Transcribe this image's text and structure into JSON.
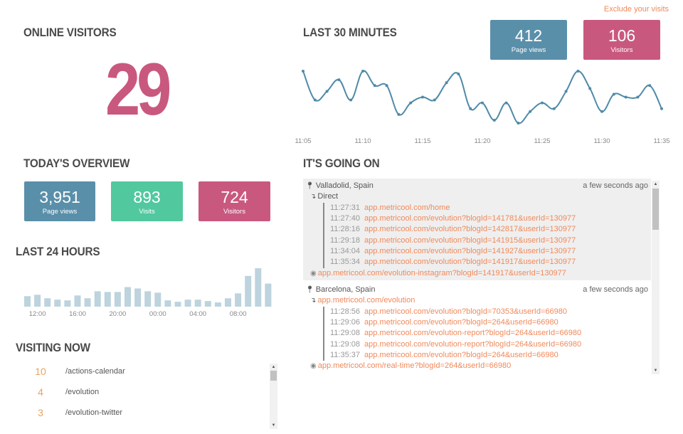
{
  "header": {
    "exclude_link": "Exclude your visits"
  },
  "online_visitors": {
    "title": "ONLINE VISITORS",
    "count": "29"
  },
  "last_30_minutes": {
    "title": "LAST 30 MINUTES",
    "page_views": {
      "value": "412",
      "label": "Page views"
    },
    "visitors": {
      "value": "106",
      "label": "Visitors"
    }
  },
  "todays_overview": {
    "title": "TODAY'S OVERVIEW",
    "page_views": {
      "value": "3,951",
      "label": "Page views"
    },
    "visits": {
      "value": "893",
      "label": "Visits"
    },
    "visitors": {
      "value": "724",
      "label": "Visitors"
    }
  },
  "last_24_hours": {
    "title": "LAST 24 HOURS"
  },
  "visiting_now": {
    "title": "VISITING NOW",
    "items": [
      {
        "count": "10",
        "path": "/actions-calendar"
      },
      {
        "count": "4",
        "path": "/evolution"
      },
      {
        "count": "3",
        "path": "/evolution-twitter"
      }
    ]
  },
  "its_going_on": {
    "title": "IT'S GOING ON",
    "sessions": [
      {
        "location": "Valladolid, Spain",
        "time_ago": "a few seconds ago",
        "referrer": "Direct",
        "referrer_is_link": false,
        "visits": [
          {
            "time": "11:27:31",
            "url": "app.metricool.com/home"
          },
          {
            "time": "11:27:40",
            "url": "app.metricool.com/evolution?blogId=141781&userId=130977"
          },
          {
            "time": "11:28:16",
            "url": "app.metricool.com/evolution?blogId=142817&userId=130977"
          },
          {
            "time": "11:29:18",
            "url": "app.metricool.com/evolution?blogId=141915&userId=130977"
          },
          {
            "time": "11:34:04",
            "url": "app.metricool.com/evolution?blogId=141927&userId=130977"
          },
          {
            "time": "11:35:34",
            "url": "app.metricool.com/evolution?blogId=141917&userId=130977"
          }
        ],
        "current_page": "app.metricool.com/evolution-instagram?blogId=141917&userId=130977"
      },
      {
        "location": "Barcelona, Spain",
        "time_ago": "a few seconds ago",
        "referrer": "app.metricool.com/evolution",
        "referrer_is_link": true,
        "visits": [
          {
            "time": "11:28:56",
            "url": "app.metricool.com/evolution?blogId=70353&userId=66980"
          },
          {
            "time": "11:29:06",
            "url": "app.metricool.com/evolution?blogId=264&userId=66980"
          },
          {
            "time": "11:29:08",
            "url": "app.metricool.com/evolution-report?blogId=264&userId=66980"
          },
          {
            "time": "11:29:08",
            "url": "app.metricool.com/evolution-report?blogId=264&userId=66980"
          },
          {
            "time": "11:35:37",
            "url": "app.metricool.com/evolution?blogId=264&userId=66980"
          }
        ],
        "current_page": "app.metricool.com/real-time?blogId=264&userId=66980"
      }
    ]
  },
  "icons": {
    "location": "map-marker-icon",
    "referrer": "level-down-icon",
    "current_page": "eye-icon"
  },
  "colors": {
    "blue": "#5a8faa",
    "pink": "#c9587f",
    "green": "#52c89f",
    "link": "#f0895a",
    "line": "#4f8aa8",
    "bar": "#bdd3de",
    "count": "#eaa35c"
  },
  "chart_data": [
    {
      "type": "line",
      "title": "LAST 30 MINUTES",
      "x": [
        "11:05",
        "11:06",
        "11:07",
        "11:08",
        "11:09",
        "11:10",
        "11:11",
        "11:12",
        "11:13",
        "11:14",
        "11:15",
        "11:16",
        "11:17",
        "11:18",
        "11:19",
        "11:20",
        "11:21",
        "11:22",
        "11:23",
        "11:24",
        "11:25",
        "11:26",
        "11:27",
        "11:28",
        "11:29",
        "11:30",
        "11:31",
        "11:32",
        "11:33",
        "11:34",
        "11:35"
      ],
      "x_tick_labels": [
        "11:05",
        "11:10",
        "11:15",
        "11:20",
        "11:25",
        "11:30",
        "11:35"
      ],
      "values": [
        18,
        8,
        11,
        15,
        8,
        18,
        13,
        13,
        3,
        7,
        9,
        8,
        14,
        17,
        5,
        7,
        1,
        7,
        0,
        4,
        7,
        5,
        11,
        18,
        12,
        4,
        10,
        9,
        9,
        13,
        5
      ],
      "ylim": [
        0,
        18
      ],
      "grid": false,
      "legend": "none",
      "xlabel": "",
      "ylabel": ""
    },
    {
      "type": "bar",
      "title": "LAST 24 HOURS",
      "categories": [
        "11:00",
        "12:00",
        "13:00",
        "14:00",
        "15:00",
        "16:00",
        "17:00",
        "18:00",
        "19:00",
        "20:00",
        "21:00",
        "22:00",
        "23:00",
        "00:00",
        "01:00",
        "02:00",
        "03:00",
        "04:00",
        "05:00",
        "06:00",
        "07:00",
        "08:00",
        "09:00",
        "10:00",
        "11:00"
      ],
      "x_tick_labels": [
        "12:00",
        "16:00",
        "20:00",
        "00:00",
        "04:00",
        "08:00"
      ],
      "values": [
        15,
        17,
        12,
        10,
        9,
        16,
        12,
        22,
        21,
        21,
        28,
        26,
        22,
        20,
        9,
        7,
        10,
        10,
        8,
        6,
        12,
        19,
        44,
        55,
        33
      ],
      "ylim": [
        0,
        55
      ],
      "grid": false,
      "legend": "none",
      "xlabel": "",
      "ylabel": ""
    }
  ]
}
